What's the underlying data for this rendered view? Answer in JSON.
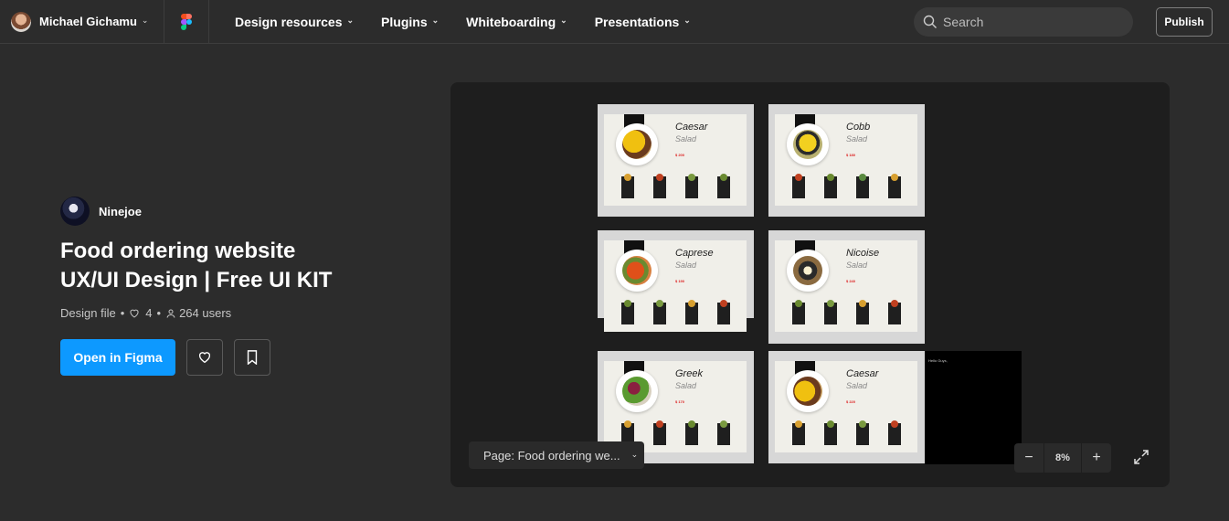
{
  "header": {
    "user_name": "Michael Gichamu",
    "nav": [
      "Design resources",
      "Plugins",
      "Whiteboarding",
      "Presentations"
    ],
    "search_placeholder": "Search",
    "publish_label": "Publish"
  },
  "file": {
    "author": "Ninejoe",
    "title_line1": "Food ordering website",
    "title_line2": "UX/UI Design | Free UI KIT",
    "type": "Design file",
    "likes": "4",
    "users": "264 users",
    "open_label": "Open in Figma"
  },
  "preview": {
    "frames": [
      {
        "dish": "Caesar",
        "salad": "Salad",
        "price": "$ 200"
      },
      {
        "dish": "Cobb",
        "salad": "Salad",
        "price": "$ 180"
      },
      {
        "dish": "Caprese",
        "salad": "Salad",
        "price": "$ 190"
      },
      {
        "dish": "Nicoise",
        "salad": "Salad",
        "price": "$ 240"
      },
      {
        "dish": "Greek",
        "salad": "Salad",
        "price": "$ 170"
      },
      {
        "dish": "Caesar",
        "salad": "Salad",
        "price": "$ 220"
      }
    ],
    "note_title": "Hello Guys,",
    "page_selector": "Page: Food ordering we...",
    "zoom_level": "8%"
  },
  "colors": {
    "accent": "#0d99ff",
    "background": "#2c2c2c",
    "canvas": "#1e1e1e"
  }
}
